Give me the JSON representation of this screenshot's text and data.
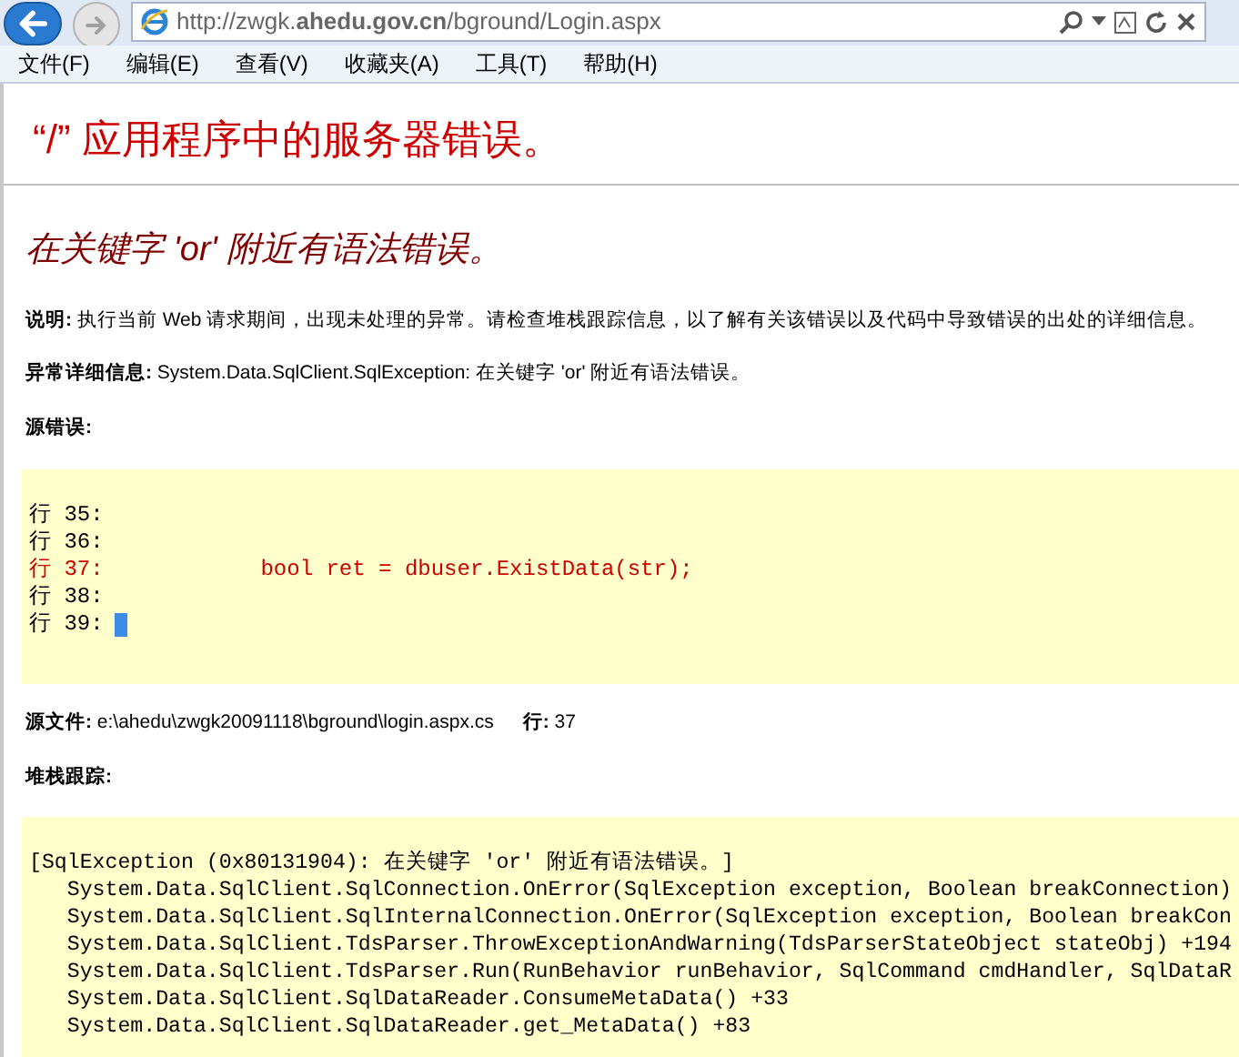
{
  "browser": {
    "url": "http://zwgk.**ahedu.gov.cn**/bground/Login.aspx"
  },
  "menu": [
    "文件(F)",
    "编辑(E)",
    "查看(V)",
    "收藏夹(A)",
    "工具(T)",
    "帮助(H)"
  ],
  "page": {
    "title": "“/” 应用程序中的服务器错误。",
    "error_heading": "在关键字 'or' 附近有语法错误。",
    "description": {
      "label": "说明:",
      "text": "执行当前 Web 请求期间，出现未处理的异常。请检查堆栈跟踪信息，以了解有关该错误以及代码中导致错误的出处的详细信息。"
    },
    "exception_details": {
      "label": "异常详细信息:",
      "text": "System.Data.SqlClient.SqlException: 在关键字 'or' 附近有语法错误。"
    },
    "source_error_label": "源错误:",
    "source_lines": [
      {
        "prefix": "行 35:",
        "highlighted": false,
        "cursor": false
      },
      {
        "prefix": "行 36:",
        "highlighted": false,
        "cursor": false
      },
      {
        "prefix": "行 37:",
        "code": "            bool ret = dbuser.ExistData(str);",
        "highlighted": true,
        "cursor": false
      },
      {
        "prefix": "行 38:",
        "highlighted": false,
        "cursor": false
      },
      {
        "prefix": "行 39:",
        "highlighted": false,
        "cursor": true
      }
    ],
    "source_file": {
      "label": "源文件:",
      "path": "e:\\ahedu\\zwgk20091118\\bground\\login.aspx.cs",
      "line_label": "行:",
      "line": "37"
    },
    "stack_trace_label": "堆栈跟踪:",
    "stack_trace": [
      "[SqlException (0x80131904): 在关键字 'or' 附近有语法错误。]",
      "   System.Data.SqlClient.SqlConnection.OnError(SqlException exception, Boolean breakConnection)",
      "   System.Data.SqlClient.SqlInternalConnection.OnError(SqlException exception, Boolean breakCon",
      "   System.Data.SqlClient.TdsParser.ThrowExceptionAndWarning(TdsParserStateObject stateObj) +194",
      "   System.Data.SqlClient.TdsParser.Run(RunBehavior runBehavior, SqlCommand cmdHandler, SqlDataR",
      "   System.Data.SqlClient.SqlDataReader.ConsumeMetaData() +33",
      "   System.Data.SqlClient.SqlDataReader.get_MetaData() +83"
    ]
  }
}
